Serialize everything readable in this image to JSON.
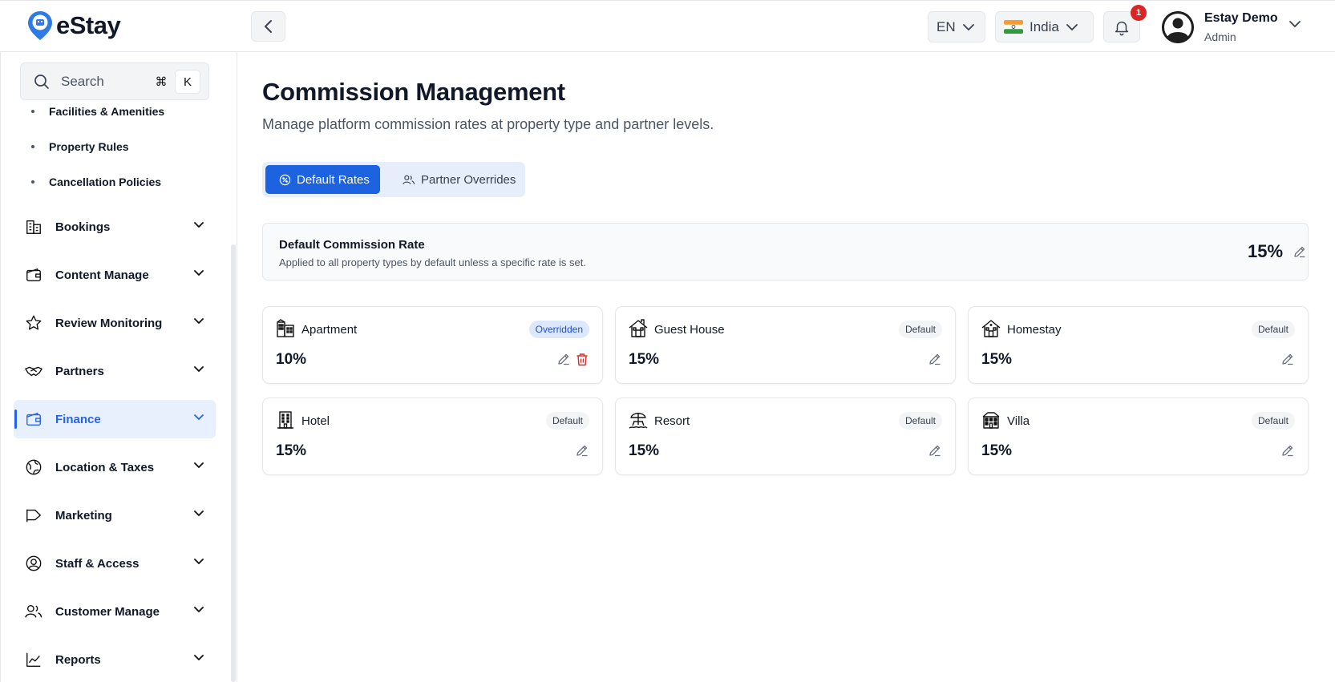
{
  "brand": {
    "name": "eStay"
  },
  "header": {
    "language": "EN",
    "country": "India",
    "notification_count": "1",
    "user_name": "Estay Demo",
    "user_role": "Admin"
  },
  "sidebar": {
    "search_label": "Search",
    "shortcut_symbol": "⌘",
    "shortcut_key": "K",
    "sub_items": [
      {
        "label": "Facilities & Amenities"
      },
      {
        "label": "Property Rules"
      },
      {
        "label": "Cancellation Policies"
      }
    ],
    "items": [
      {
        "label": "Bookings",
        "icon": "building-icon"
      },
      {
        "label": "Content Manage",
        "icon": "wallet-icon"
      },
      {
        "label": "Review Monitoring",
        "icon": "star-icon"
      },
      {
        "label": "Partners",
        "icon": "handshake-icon"
      },
      {
        "label": "Finance",
        "icon": "wallet-icon",
        "active": true
      },
      {
        "label": "Location & Taxes",
        "icon": "globe-icon"
      },
      {
        "label": "Marketing",
        "icon": "megaphone-icon"
      },
      {
        "label": "Staff & Access",
        "icon": "user-circle-icon"
      },
      {
        "label": "Customer Manage",
        "icon": "users-icon"
      },
      {
        "label": "Reports",
        "icon": "chart-line-icon"
      }
    ]
  },
  "page": {
    "title": "Commission Management",
    "subtitle": "Manage platform commission rates at property type and partner levels.",
    "tabs": [
      {
        "label": "Default Rates",
        "active": true
      },
      {
        "label": "Partner Overrides",
        "active": false
      }
    ],
    "default_rate": {
      "title": "Default Commission Rate",
      "description": "Applied to all property types by default unless a specific rate is set.",
      "value": "15%"
    },
    "property_types": [
      {
        "name": "Apartment",
        "rate": "10%",
        "status": "Overridden"
      },
      {
        "name": "Guest House",
        "rate": "15%",
        "status": "Default"
      },
      {
        "name": "Homestay",
        "rate": "15%",
        "status": "Default"
      },
      {
        "name": "Hotel",
        "rate": "15%",
        "status": "Default"
      },
      {
        "name": "Resort",
        "rate": "15%",
        "status": "Default"
      },
      {
        "name": "Villa",
        "rate": "15%",
        "status": "Default"
      }
    ]
  },
  "colors": {
    "accent": "#1d63e0",
    "active_bg": "#e8f0fd",
    "danger": "#dc2626"
  }
}
